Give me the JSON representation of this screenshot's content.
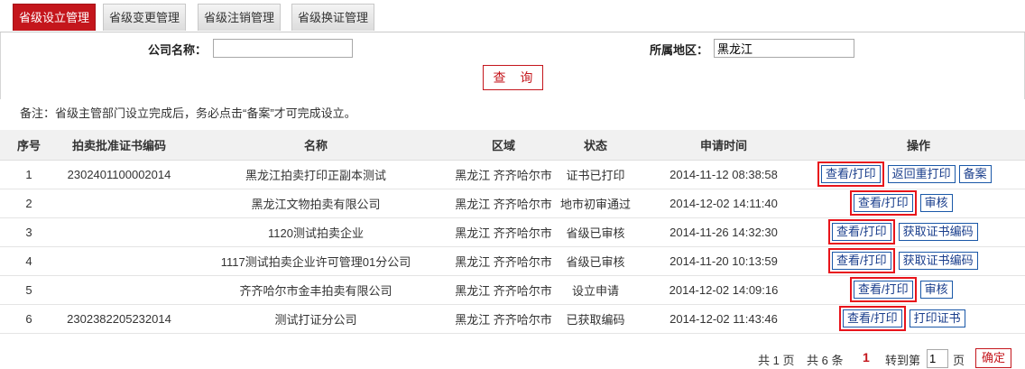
{
  "tabs": [
    {
      "label": "省级设立管理",
      "active": true
    },
    {
      "label": "省级变更管理",
      "active": false
    },
    {
      "label": "省级注销管理",
      "active": false
    },
    {
      "label": "省级换证管理",
      "active": false
    }
  ],
  "search": {
    "company_label": "公司名称：",
    "company_value": "",
    "region_label": "所属地区：",
    "region_value": "黑龙江",
    "query_button": "查 询"
  },
  "note": "备注：省级主管部门设立完成后，务必点击“备案”才可完成设立。",
  "table": {
    "headers": [
      "序号",
      "拍卖批准证书编码",
      "名称",
      "区域",
      "状态",
      "申请时间",
      "操作"
    ],
    "rows": [
      {
        "no": "1",
        "code": "2302401100002014",
        "name": "黑龙江拍卖打印正副本测试",
        "region": "黑龙江 齐齐哈尔市",
        "status": "证书已打印",
        "time": "2014-11-12 08:38:58",
        "actions": [
          "查看/打印",
          "返回重打印",
          "备案"
        ]
      },
      {
        "no": "2",
        "code": "",
        "name": "黑龙江文物拍卖有限公司",
        "region": "黑龙江 齐齐哈尔市",
        "status": "地市初审通过",
        "time": "2014-12-02 14:11:40",
        "actions": [
          "查看/打印",
          "审核"
        ]
      },
      {
        "no": "3",
        "code": "",
        "name": "1120测试拍卖企业",
        "region": "黑龙江 齐齐哈尔市",
        "status": "省级已审核",
        "time": "2014-11-26 14:32:30",
        "actions": [
          "查看/打印",
          "获取证书编码"
        ]
      },
      {
        "no": "4",
        "code": "",
        "name": "1117测试拍卖企业许可管理01分公司",
        "region": "黑龙江 齐齐哈尔市",
        "status": "省级已审核",
        "time": "2014-11-20 10:13:59",
        "actions": [
          "查看/打印",
          "获取证书编码"
        ]
      },
      {
        "no": "5",
        "code": "",
        "name": "齐齐哈尔市金丰拍卖有限公司",
        "region": "黑龙江 齐齐哈尔市",
        "status": "设立申请",
        "time": "2014-12-02 14:09:16",
        "actions": [
          "查看/打印",
          "审核"
        ]
      },
      {
        "no": "6",
        "code": "2302382205232014",
        "name": "测试打证分公司",
        "region": "黑龙江 齐齐哈尔市",
        "status": "已获取编码",
        "time": "2014-12-02 11:43:46",
        "actions": [
          "查看/打印",
          "打印证书"
        ]
      }
    ]
  },
  "pager": {
    "total_pages": "共 1 页",
    "total_items": "共 6 条",
    "current": "1",
    "goto_label": "转到第",
    "goto_value": "1",
    "page_unit": "页",
    "confirm": "确定"
  },
  "colors": {
    "accent": "#c4161c",
    "link": "#1a3e8c",
    "highlight": "#e8141b"
  }
}
